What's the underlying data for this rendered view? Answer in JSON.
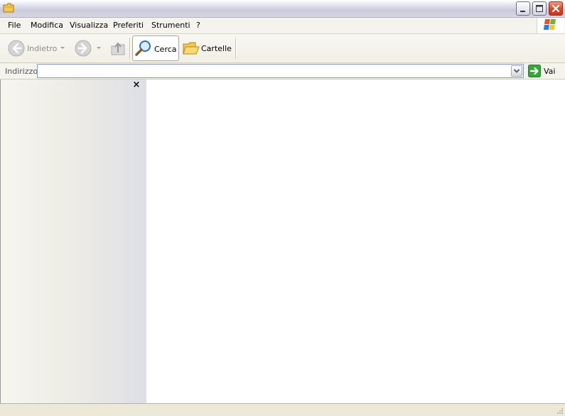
{
  "window": {
    "icon": "folder-icon",
    "controls": [
      "minimize-icon",
      "maximize-icon",
      "close-icon"
    ]
  },
  "menu": {
    "items": [
      "File",
      "Modifica",
      "Visualizza",
      "Preferiti",
      "Strumenti",
      "?"
    ]
  },
  "toolbar": {
    "back_label": "Indietro",
    "search_label": "Cerca",
    "folders_label": "Cartelle"
  },
  "address": {
    "label": "Indirizzo",
    "value": "",
    "go_label": "Vai"
  },
  "explorer_pane": {
    "close_glyph": "×"
  },
  "colors": {
    "window_bg": "#ECE9D8",
    "go_green": "#3AA53A",
    "close_red": "#D4482A"
  }
}
